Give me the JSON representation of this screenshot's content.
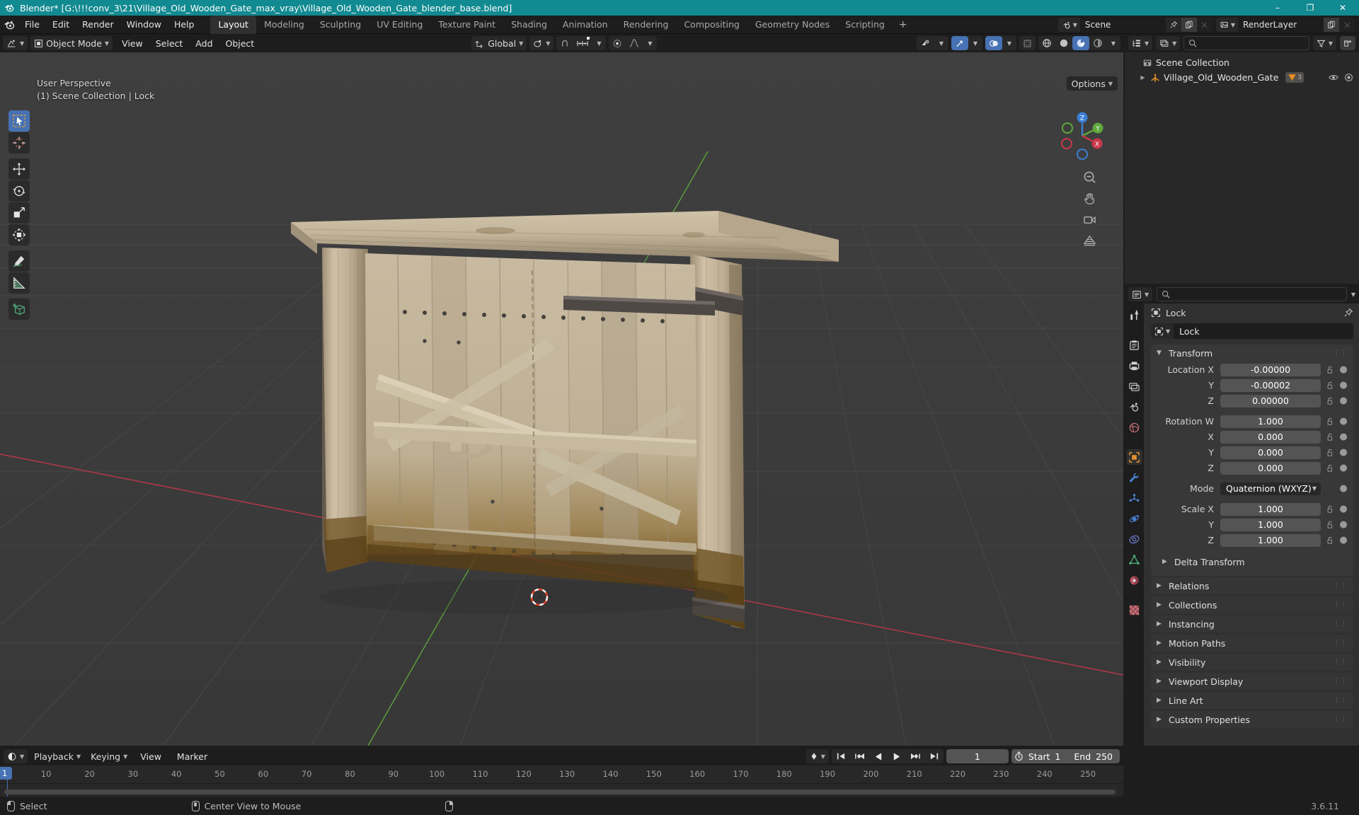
{
  "titlebar": {
    "text": "Blender* [G:\\!!!conv_3\\21\\Village_Old_Wooden_Gate_max_vray\\Village_Old_Wooden_Gate_blender_base.blend]",
    "minimize": "–",
    "maximize": "❐",
    "close": "✕"
  },
  "topbar": {
    "menus": [
      "File",
      "Edit",
      "Render",
      "Window",
      "Help"
    ],
    "workspaces": [
      {
        "label": "Layout",
        "active": true
      },
      {
        "label": "Modeling",
        "active": false
      },
      {
        "label": "Sculpting",
        "active": false
      },
      {
        "label": "UV Editing",
        "active": false
      },
      {
        "label": "Texture Paint",
        "active": false
      },
      {
        "label": "Shading",
        "active": false
      },
      {
        "label": "Animation",
        "active": false
      },
      {
        "label": "Rendering",
        "active": false
      },
      {
        "label": "Compositing",
        "active": false
      },
      {
        "label": "Geometry Nodes",
        "active": false
      },
      {
        "label": "Scripting",
        "active": false
      }
    ],
    "add_workspace": "+",
    "scene_name": "Scene",
    "viewlayer_name": "RenderLayer"
  },
  "viewport": {
    "mode": "Object Mode",
    "menus": [
      "View",
      "Select",
      "Add",
      "Object"
    ],
    "transform_orientation": "Global",
    "options_label": "Options",
    "overlay_line1": "User Perspective",
    "overlay_line2": "(1) Scene Collection | Lock",
    "gizmo_axes": {
      "x": "X",
      "y": "Y",
      "z": "Z"
    },
    "tools": [
      {
        "name": "tweak-select-box",
        "active": true
      },
      {
        "name": "cursor",
        "active": false
      },
      {
        "name": "move",
        "active": false
      },
      {
        "name": "rotate",
        "active": false
      },
      {
        "name": "scale",
        "active": false
      },
      {
        "name": "transform",
        "active": false
      },
      {
        "name": "annotate",
        "active": false
      },
      {
        "name": "measure",
        "active": false
      },
      {
        "name": "add-cube",
        "active": false
      }
    ],
    "shading_modes": [
      "wireframe",
      "solid",
      "material-preview",
      "rendered"
    ],
    "active_shading": "material-preview"
  },
  "outliner": {
    "search_placeholder": "",
    "rows": [
      {
        "label": "Scene Collection",
        "indent": 0,
        "icon": "collection-icon",
        "expand": "",
        "count": ""
      },
      {
        "label": "Village_Old_Wooden_Gate",
        "indent": 1,
        "icon": "empty-axes-icon",
        "expand": "▶",
        "count": "3"
      }
    ]
  },
  "properties": {
    "breadcrumb_object": "Lock",
    "object_name": "Lock",
    "transform": {
      "title": "Transform",
      "rows": [
        {
          "label": "Location X",
          "value": "-0.00000",
          "lock": true
        },
        {
          "label": "Y",
          "value": "-0.00002",
          "lock": true
        },
        {
          "label": "Z",
          "value": "0.00000",
          "lock": true
        },
        {
          "label": "Rotation W",
          "value": "1.000",
          "lock": true
        },
        {
          "label": "X",
          "value": "0.000",
          "lock": true
        },
        {
          "label": "Y",
          "value": "0.000",
          "lock": true
        },
        {
          "label": "Z",
          "value": "0.000",
          "lock": true
        }
      ],
      "mode_label": "Mode",
      "mode_value": "Quaternion (WXYZ)",
      "scale_rows": [
        {
          "label": "Scale X",
          "value": "1.000",
          "lock": true
        },
        {
          "label": "Y",
          "value": "1.000",
          "lock": true
        },
        {
          "label": "Z",
          "value": "1.000",
          "lock": true
        }
      ],
      "delta_transform": "Delta Transform"
    },
    "collapsed_panels": [
      "Relations",
      "Collections",
      "Instancing",
      "Motion Paths",
      "Visibility",
      "Viewport Display",
      "Line Art",
      "Custom Properties"
    ],
    "tabs": [
      {
        "name": "tool-tab",
        "active": false
      },
      {
        "name": "render-tab",
        "active": false
      },
      {
        "name": "output-tab",
        "active": false
      },
      {
        "name": "view-layer-tab",
        "active": false
      },
      {
        "name": "scene-tab",
        "active": false
      },
      {
        "name": "world-tab",
        "active": false
      },
      {
        "name": "object-tab",
        "active": true
      },
      {
        "name": "modifiers-tab",
        "active": false
      },
      {
        "name": "particles-tab",
        "active": false
      },
      {
        "name": "physics-tab",
        "active": false
      },
      {
        "name": "constraints-tab",
        "active": false
      },
      {
        "name": "data-tab",
        "active": false
      },
      {
        "name": "material-tab",
        "active": false
      },
      {
        "name": "texture-tab",
        "active": false
      }
    ]
  },
  "timeline": {
    "menus": [
      "Playback",
      "Keying",
      "View",
      "Marker"
    ],
    "current_frame": "1",
    "start_label": "Start",
    "start_value": "1",
    "end_label": "End",
    "end_value": "250",
    "ticks": [
      {
        "label": "1",
        "pos": 1
      },
      {
        "label": "10",
        "pos": 10
      },
      {
        "label": "20",
        "pos": 20
      },
      {
        "label": "30",
        "pos": 30
      },
      {
        "label": "40",
        "pos": 40
      },
      {
        "label": "50",
        "pos": 50
      },
      {
        "label": "60",
        "pos": 60
      },
      {
        "label": "70",
        "pos": 70
      },
      {
        "label": "80",
        "pos": 80
      },
      {
        "label": "90",
        "pos": 90
      },
      {
        "label": "100",
        "pos": 100
      },
      {
        "label": "110",
        "pos": 110
      },
      {
        "label": "120",
        "pos": 120
      },
      {
        "label": "130",
        "pos": 130
      },
      {
        "label": "140",
        "pos": 140
      },
      {
        "label": "150",
        "pos": 150
      },
      {
        "label": "160",
        "pos": 160
      },
      {
        "label": "170",
        "pos": 170
      },
      {
        "label": "180",
        "pos": 180
      },
      {
        "label": "190",
        "pos": 190
      },
      {
        "label": "200",
        "pos": 200
      },
      {
        "label": "210",
        "pos": 210
      },
      {
        "label": "220",
        "pos": 220
      },
      {
        "label": "230",
        "pos": 230
      },
      {
        "label": "240",
        "pos": 240
      },
      {
        "label": "250",
        "pos": 250
      }
    ]
  },
  "statusbar": {
    "item1": "Select",
    "item2": "Center View to Mouse",
    "version": "3.6.11"
  },
  "colors": {
    "title_bg": "#128a91",
    "accent_blue": "#4772b3",
    "panel_bg": "#303030",
    "editor_bg": "#1d1d1d",
    "viewport_bg": "#3b3b3b",
    "axis_x": "#c9384a",
    "axis_y": "#5ea83c",
    "axis_z": "#3b7fd4",
    "orange": "#e8922b"
  }
}
